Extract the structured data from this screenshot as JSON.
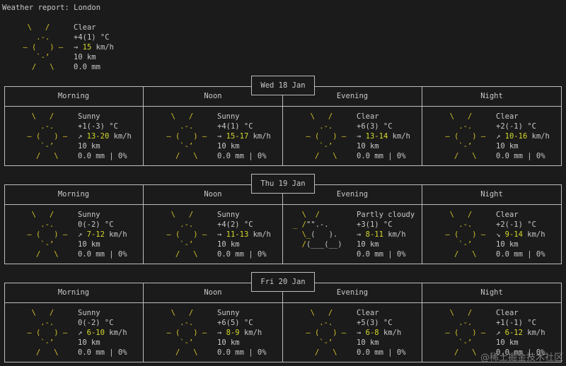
{
  "header": {
    "title": "Weather report: London"
  },
  "current": {
    "condition": "Clear",
    "temp": "+4(1) °C",
    "wind_dir": "→",
    "wind_speed": "15",
    "wind_unit": "km/h",
    "visibility": "10 km",
    "precip": "0.0 mm",
    "icon": "sun-icon"
  },
  "columns": [
    "Morning",
    "Noon",
    "Evening",
    "Night"
  ],
  "days": [
    {
      "date": "Wed 18 Jan",
      "periods": [
        {
          "condition": "Sunny",
          "temp": "+1(-3) °C",
          "wind_dir": "↗",
          "wind": "13-20",
          "unit": "km/h",
          "vis": "10 km",
          "precip": "0.0 mm | 0%",
          "icon": "sun-icon"
        },
        {
          "condition": "Sunny",
          "temp": "+4(1) °C",
          "wind_dir": "→",
          "wind": "15-17",
          "unit": "km/h",
          "vis": "10 km",
          "precip": "0.0 mm | 0%",
          "icon": "sun-icon"
        },
        {
          "condition": "Clear",
          "temp": "+6(3) °C",
          "wind_dir": "→",
          "wind": "13-14",
          "unit": "km/h",
          "vis": "10 km",
          "precip": "0.0 mm | 0%",
          "icon": "sun-icon"
        },
        {
          "condition": "Clear",
          "temp": "+2(-1) °C",
          "wind_dir": "↗",
          "wind": "10-16",
          "unit": "km/h",
          "vis": "10 km",
          "precip": "0.0 mm | 0%",
          "icon": "sun-icon"
        }
      ]
    },
    {
      "date": "Thu 19 Jan",
      "periods": [
        {
          "condition": "Sunny",
          "temp": "0(-2) °C",
          "wind_dir": "↗",
          "wind": "7-12",
          "unit": "km/h",
          "vis": "10 km",
          "precip": "0.0 mm | 0%",
          "icon": "sun-icon"
        },
        {
          "condition": "Sunny",
          "temp": "+4(2) °C",
          "wind_dir": "→",
          "wind": "11-13",
          "unit": "km/h",
          "vis": "10 km",
          "precip": "0.0 mm | 0%",
          "icon": "sun-icon"
        },
        {
          "condition": "Partly cloudy",
          "temp": "+3(1) °C",
          "wind_dir": "→",
          "wind": "8-11",
          "unit": "km/h",
          "vis": "10 km",
          "precip": "0.0 mm | 0%",
          "icon": "partly-cloudy-icon"
        },
        {
          "condition": "Clear",
          "temp": "+2(-1) °C",
          "wind_dir": "↘",
          "wind": "9-14",
          "unit": "km/h",
          "vis": "10 km",
          "precip": "0.0 mm | 0%",
          "icon": "sun-icon"
        }
      ]
    },
    {
      "date": "Fri 20 Jan",
      "periods": [
        {
          "condition": "Sunny",
          "temp": "0(-2) °C",
          "wind_dir": "↗",
          "wind": "6-10",
          "unit": "km/h",
          "vis": "10 km",
          "precip": "0.0 mm | 0%",
          "icon": "sun-icon"
        },
        {
          "condition": "Sunny",
          "temp": "+6(5) °C",
          "wind_dir": "→",
          "wind": "8-9",
          "unit": "km/h",
          "vis": "10 km",
          "precip": "0.0 mm | 0%",
          "icon": "sun-icon"
        },
        {
          "condition": "Clear",
          "temp": "+5(3) °C",
          "wind_dir": "→",
          "wind": "6-8",
          "unit": "km/h",
          "vis": "10 km",
          "precip": "0.0 mm | 0%",
          "icon": "sun-icon"
        },
        {
          "condition": "Clear",
          "temp": "+1(-1) °C",
          "wind_dir": "↗",
          "wind": "6-12",
          "unit": "km/h",
          "vis": "10 km",
          "precip": "0.0 mm | 0%",
          "icon": "sun-icon"
        }
      ]
    }
  ],
  "watermark": "@稀土掘金技术社区",
  "colors": {
    "background": "#1b1b1b",
    "text": "#c8c8c8",
    "sun": "#d4c22a",
    "wind": "#d4d82a",
    "border": "#bdbdbd"
  }
}
